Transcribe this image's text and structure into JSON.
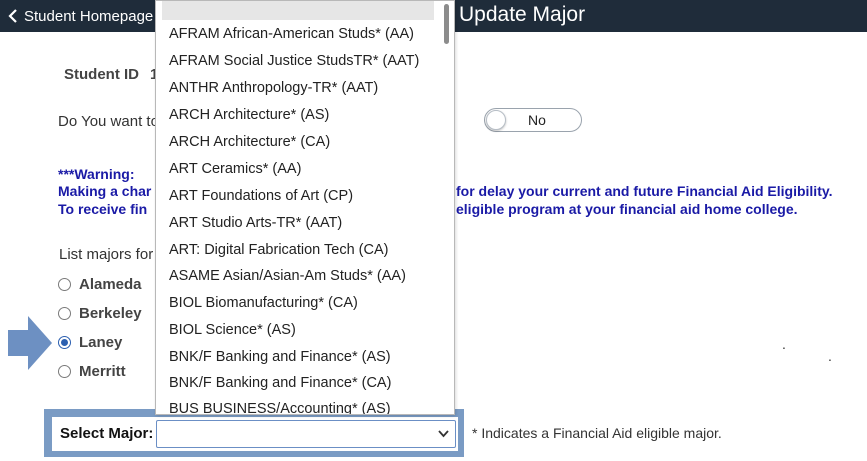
{
  "header": {
    "back_label": "Student Homepage",
    "title": "Update Major",
    "background": "#1f2c3a"
  },
  "student": {
    "id_label": "Student ID",
    "id_value_partial": "1"
  },
  "question": {
    "text_partial": "Do You want to",
    "toggle_value": "No"
  },
  "warning": {
    "title": "***Warning:",
    "line1_left": "Making a char",
    "line1_right": "for delay your current and future Financial Aid Eligibility.",
    "line2_left": "To receive fin",
    "line2_right": "eligible program at your financial aid home college.",
    "color": "#1a1aa6"
  },
  "colleges": {
    "label_partial": "List majors for",
    "options": [
      {
        "label": "Alameda",
        "checked": false
      },
      {
        "label": "Berkeley",
        "checked": false
      },
      {
        "label": "Laney",
        "checked": true
      },
      {
        "label": "Merritt",
        "checked": false
      }
    ]
  },
  "select_major": {
    "label": "Select Major:",
    "value": "",
    "note": "* Indicates a Financial Aid eligible major.",
    "highlight_color": "#7a9bc4"
  },
  "dropdown": {
    "options": [
      "AFRAM African-American Studs* (AA)",
      "AFRAM Social Justice StudsTR* (AAT)",
      "ANTHR Anthropology-TR* (AAT)",
      "ARCH Architecture* (AS)",
      "ARCH Architecture* (CA)",
      "ART Ceramics* (AA)",
      "ART Foundations of Art (CP)",
      "ART Studio Arts-TR* (AAT)",
      "ART: Digital Fabrication Tech (CA)",
      "ASAME Asian/Asian-Am Studs* (AA)",
      "BIOL Biomanufacturing* (CA)",
      "BIOL Science* (AS)",
      "BNK/F Banking and Finance* (AS)",
      "BNK/F Banking and Finance* (CA)",
      "BUS BUSINESS/Accounting* (AS)"
    ]
  },
  "misc": {
    "dot1": ".",
    "dot2": "."
  }
}
